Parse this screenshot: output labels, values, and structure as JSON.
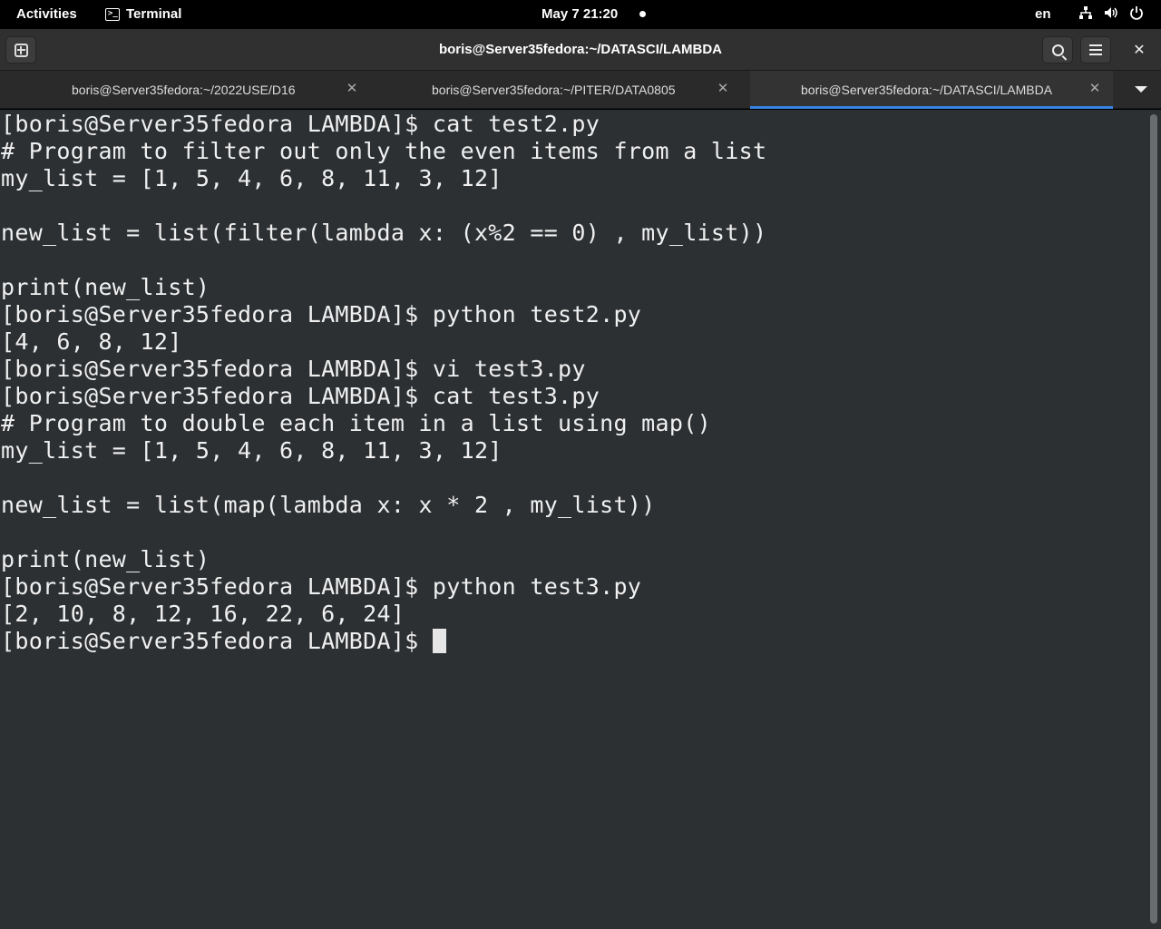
{
  "topbar": {
    "activities": "Activities",
    "app_name": "Terminal",
    "clock": "May 7  21:20",
    "language": "en",
    "icons": [
      "network-icon",
      "volume-icon",
      "power-icon"
    ]
  },
  "window": {
    "title": "boris@Server35fedora:~/DATASCI/LAMBDA"
  },
  "tabs": [
    {
      "label": "boris@Server35fedora:~/2022USE/D16",
      "active": false
    },
    {
      "label": "boris@Server35fedora:~/PITER/DATA0805",
      "active": false
    },
    {
      "label": "boris@Server35fedora:~/DATASCI/LAMBDA",
      "active": true
    }
  ],
  "colors": {
    "terminal_bg": "#2d3033",
    "accent": "#3584e4"
  },
  "terminal": {
    "lines": [
      "[boris@Server35fedora LAMBDA]$ cat test2.py",
      "# Program to filter out only the even items from a list",
      "my_list = [1, 5, 4, 6, 8, 11, 3, 12]",
      "",
      "new_list = list(filter(lambda x: (x%2 == 0) , my_list))",
      "",
      "print(new_list)",
      "[boris@Server35fedora LAMBDA]$ python test2.py",
      "[4, 6, 8, 12]",
      "[boris@Server35fedora LAMBDA]$ vi test3.py",
      "[boris@Server35fedora LAMBDA]$ cat test3.py",
      "# Program to double each item in a list using map()",
      "my_list = [1, 5, 4, 6, 8, 11, 3, 12]",
      "",
      "new_list = list(map(lambda x: x * 2 , my_list))",
      "",
      "print(new_list)",
      "[boris@Server35fedora LAMBDA]$ python test3.py",
      "[2, 10, 8, 12, 16, 22, 6, 24]"
    ],
    "prompt": "[boris@Server35fedora LAMBDA]$ "
  }
}
